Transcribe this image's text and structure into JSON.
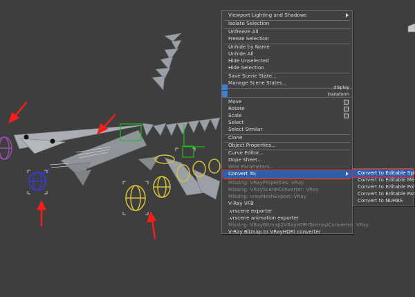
{
  "quad_menu": {
    "items": [
      {
        "label": "Viewport Lighting and Shadows",
        "submenu": true
      },
      {
        "label": "Isolate Selection"
      },
      {
        "label": "Unfreeze All"
      },
      {
        "label": "Freeze Selection"
      },
      {
        "label": "Unhide by Name"
      },
      {
        "label": "Unhide All"
      },
      {
        "label": "Hide Unselected"
      },
      {
        "label": "Hide Selection"
      },
      {
        "label": "Save Scene State..."
      },
      {
        "label": "Manage Scene States..."
      },
      {
        "label": "Move",
        "option_box": true
      },
      {
        "label": "Rotate",
        "option_box": true
      },
      {
        "label": "Scale",
        "option_box": true
      },
      {
        "label": "Select"
      },
      {
        "label": "Select Similar"
      },
      {
        "label": "Clone"
      },
      {
        "label": "Object Properties..."
      },
      {
        "label": "Curve Editor..."
      },
      {
        "label": "Dope Sheet..."
      },
      {
        "label": "Wire Parameters...",
        "disabled": true
      },
      {
        "label": "Convert To:",
        "submenu": true,
        "highlighted": true
      },
      {
        "label": "Missing: VRayProperties: VRay",
        "disabled": true
      },
      {
        "label": "Missing: VRaySceneConverter: VRay",
        "disabled": true
      },
      {
        "label": "Missing: vrayMeshExport: VRay",
        "disabled": true
      },
      {
        "label": "V-Ray VFB"
      },
      {
        "label": ".vrscene exporter"
      },
      {
        "label": ".vrscene animation exporter"
      },
      {
        "label": "Missing: VRayBitmap2VRayHDRITexmapConverter: VRay",
        "disabled": true
      },
      {
        "label": "V-Ray Bitmap to VRayHDRI converter"
      }
    ],
    "quad_labels": {
      "display": "display",
      "transform": "transform"
    }
  },
  "convert_submenu": {
    "items": [
      {
        "label": "Convert to Editable Spline",
        "highlighted": true
      },
      {
        "label": "Convert to Editable Mesh"
      },
      {
        "label": "Convert to Editable Poly"
      },
      {
        "label": "Convert to Editable Patch"
      },
      {
        "label": "Convert to NURBS"
      }
    ]
  },
  "colors": {
    "viewport_bg": "#3e3e3e",
    "menu_bg": "#414141",
    "highlight": "#2f5fa8",
    "annotation_arrow": "#ff1a1a",
    "selected_bone_purple": "#9c4fb0",
    "selected_bone_blue": "#3a3ad8",
    "bone_yellow": "#d9c23a",
    "helper_green": "#19c019"
  }
}
